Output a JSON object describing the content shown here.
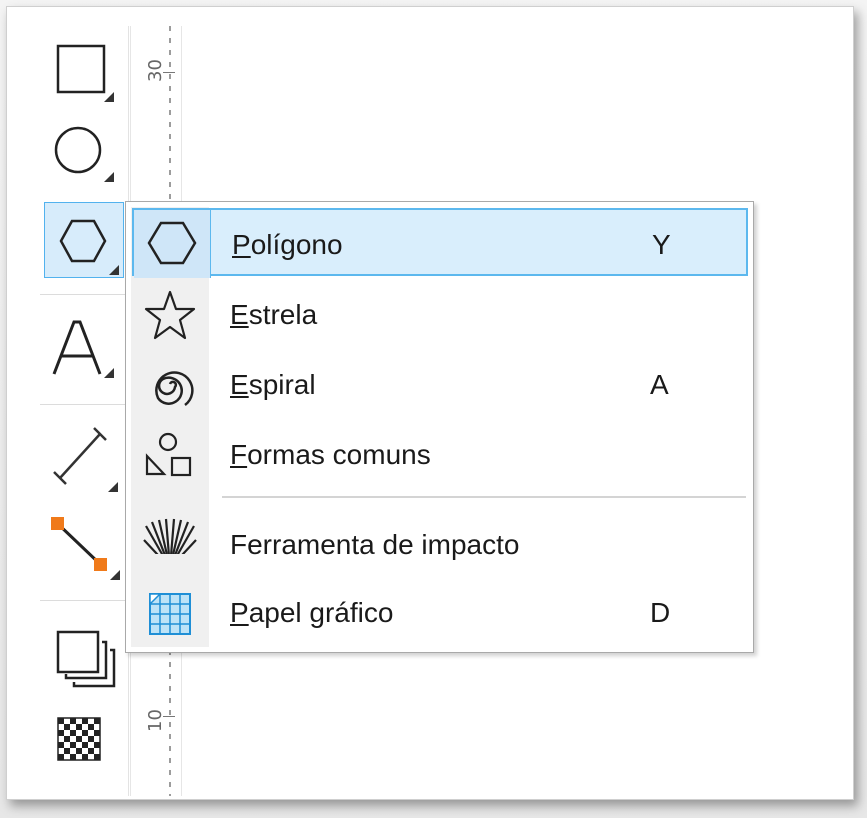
{
  "ruler": {
    "labels": [
      "30",
      "10"
    ]
  },
  "toolbox": {
    "tools": [
      {
        "name": "rectangle-tool",
        "icon": "rectangle-icon"
      },
      {
        "name": "ellipse-tool",
        "icon": "ellipse-icon"
      },
      {
        "name": "polygon-tool",
        "icon": "hexagon-icon",
        "active": true
      },
      {
        "name": "text-tool",
        "icon": "text-A-icon"
      },
      {
        "name": "dimension-tool",
        "icon": "dimension-line-icon"
      },
      {
        "name": "connector-tool",
        "icon": "connector-icon"
      },
      {
        "name": "drop-shadow-tool",
        "icon": "drop-shadow-icon"
      },
      {
        "name": "transparency-tool",
        "icon": "checkerboard-icon"
      }
    ]
  },
  "flyout": {
    "items": [
      {
        "mnemonic": "P",
        "rest": "olígono",
        "shortcut": "Y",
        "icon": "hexagon-icon",
        "highlighted": true
      },
      {
        "mnemonic": "E",
        "rest": "strela",
        "shortcut": "",
        "icon": "star-icon"
      },
      {
        "mnemonic": "E",
        "rest": "spiral",
        "shortcut": "A",
        "icon": "spiral-icon"
      },
      {
        "mnemonic": "F",
        "rest": "ormas comuns",
        "shortcut": "",
        "icon": "common-shapes-icon"
      },
      {
        "mnemonic": "",
        "rest": "Ferramenta de impacto",
        "shortcut": "",
        "icon": "impact-icon"
      },
      {
        "mnemonic": "P",
        "rest": "apel gráfico",
        "shortcut": "D",
        "icon": "graph-paper-icon"
      }
    ]
  },
  "colors": {
    "highlight_fill": "#d9eefc",
    "highlight_border": "#5cb8ee",
    "connector_accent": "#f07a1a"
  }
}
